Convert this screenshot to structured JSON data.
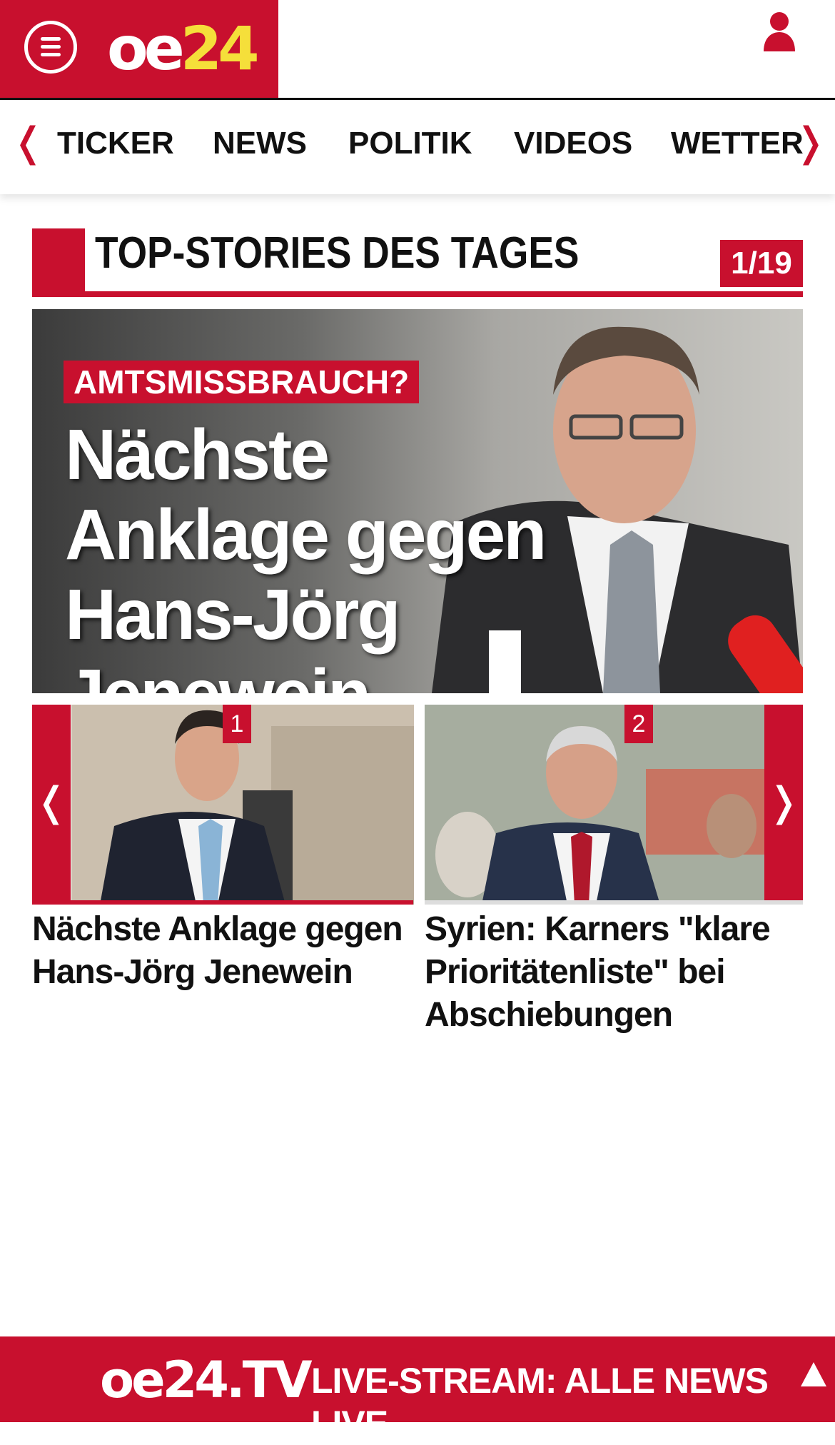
{
  "header": {
    "logo_oe": "oe",
    "logo_num": "24"
  },
  "nav": {
    "items": [
      "TICKER",
      "NEWS",
      "POLITIK",
      "VIDEOS",
      "WETTER"
    ]
  },
  "section": {
    "title": "TOP-STORIES DES TAGES",
    "counter": "1/19"
  },
  "hero": {
    "kicker": "AMTSMISSBRAUCH?",
    "headline": "Nächste Anklage gegen Hans-Jörg Jenewein"
  },
  "thumbs": [
    {
      "badge": "1",
      "caption": "Nächste Anklage gegen Hans-Jörg Jenewein"
    },
    {
      "badge": "2",
      "caption": "Syrien: Karners \"klare Prioritätenliste\" bei Abschiebungen"
    }
  ],
  "footer": {
    "tv_logo": "oe24.TV",
    "stream_text": "LIVE-STREAM:  ALLE NEWS LIVE"
  },
  "colors": {
    "brand_red": "#c8102e",
    "logo_yellow": "#f5df3a"
  }
}
